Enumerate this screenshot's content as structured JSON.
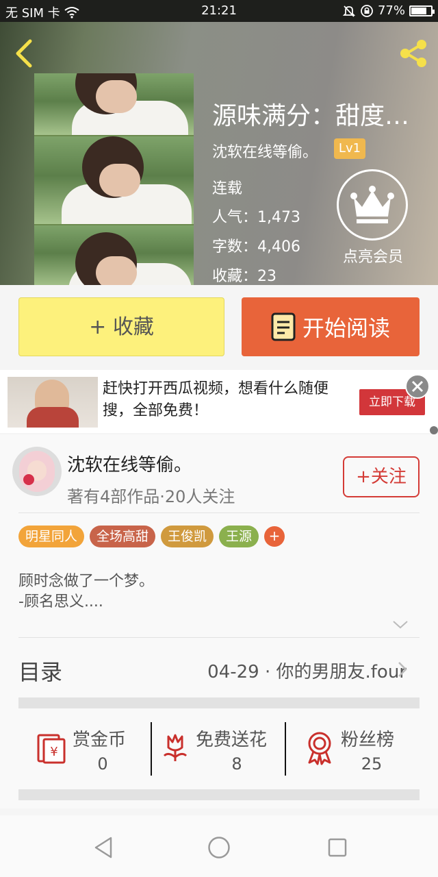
{
  "status_bar": {
    "carrier": "无 SIM 卡",
    "time": "21:21",
    "battery": "77%",
    "battery_level": 0.77
  },
  "book": {
    "title": "源味满分：甜度百...",
    "author": "沈软在线等偷。",
    "level": "Lv1",
    "status": "连载",
    "stats": [
      {
        "label": "人气：",
        "value": "1,473"
      },
      {
        "label": "字数：",
        "value": "4,406"
      },
      {
        "label": "收藏：",
        "value": "23"
      }
    ],
    "vip_label": "点亮会员"
  },
  "actions": {
    "collect": "+ 收藏",
    "read": "开始阅读"
  },
  "ad": {
    "text": "赶快打开西瓜视频，想看什么随便搜，全部免费！",
    "button": "立即下载"
  },
  "author_section": {
    "name": "沈软在线等偷。",
    "meta": "著有4部作品·20人关注",
    "follow": "+关注"
  },
  "tags": [
    {
      "label": "明星同人",
      "color": "#f2a43a"
    },
    {
      "label": "全场高甜",
      "color": "#c8644a"
    },
    {
      "label": "王俊凯",
      "color": "#d09a3e"
    },
    {
      "label": "王源",
      "color": "#8bb04e"
    }
  ],
  "tag_add": "+",
  "intro": {
    "line1": "顾时念做了一个梦。",
    "line2": "-顾名思义...."
  },
  "toc": {
    "label": "目录",
    "latest": "04-29 · 你的男朋友.four"
  },
  "rewards": [
    {
      "label": "赏金币",
      "value": "0",
      "icon": "red-envelope-icon"
    },
    {
      "label": "免费送花",
      "value": "8",
      "icon": "flower-icon"
    },
    {
      "label": "粉丝榜",
      "value": "25",
      "icon": "medal-icon"
    }
  ],
  "colors": {
    "accent_orange": "#e8643a",
    "collect_yellow": "#fdf17c",
    "follow_red": "#d43b36",
    "icon_red": "#c9302c"
  }
}
